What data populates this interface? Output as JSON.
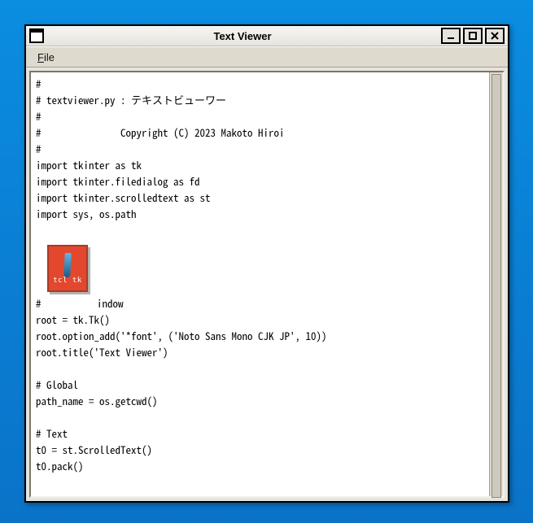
{
  "window": {
    "title": "Text Viewer"
  },
  "menubar": {
    "file_mnemonic": "F",
    "file_rest": "ile"
  },
  "embedded_image": {
    "label": "tcl tk"
  },
  "content": {
    "lines": [
      "#",
      "# textviewer.py : テキストビューワー",
      "#",
      "#               Copyright (C) 2023 Makoto Hiroi",
      "#",
      "import tkinter as tk",
      "import tkinter.filedialog as fd",
      "import tkinter.scrolledtext as st",
      "import sys, os.path",
      ""
    ],
    "line_with_image_prefix": "# ",
    "line_with_image_suffix": "indow",
    "lines_after": [
      "root = tk.Tk()",
      "root.option_add('*font', ('Noto Sans Mono CJK JP', 10))",
      "root.title('Text Viewer')",
      "",
      "# Global",
      "path_name = os.getcwd()",
      "",
      "# Text",
      "t0 = st.ScrolledText()",
      "t0.pack()"
    ]
  }
}
